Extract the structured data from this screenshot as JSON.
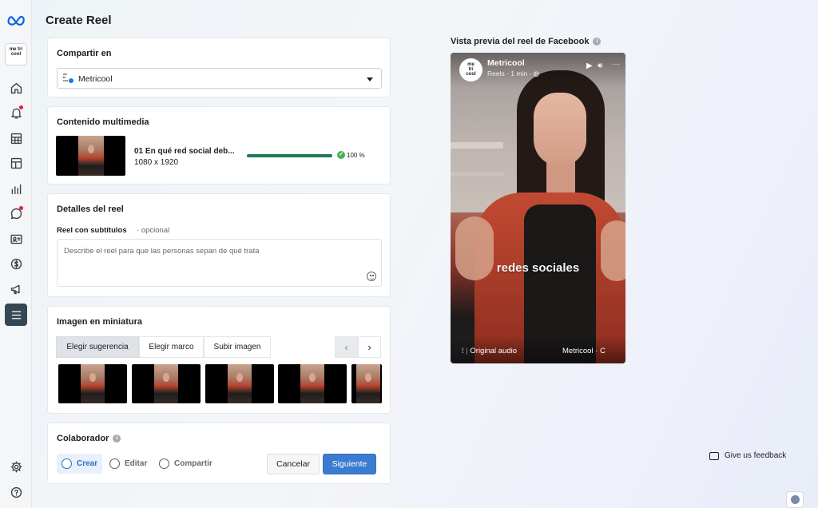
{
  "page": {
    "title": "Create Reel"
  },
  "sidebar": {
    "account_logo": "me tri cool",
    "items": [
      {
        "icon": "home-icon"
      },
      {
        "icon": "bell-icon",
        "badge": true
      },
      {
        "icon": "table-icon"
      },
      {
        "icon": "pages-icon"
      },
      {
        "icon": "bar-chart-icon"
      },
      {
        "icon": "chat-icon",
        "badge": true
      },
      {
        "icon": "contact-card-icon"
      },
      {
        "icon": "dollar-icon"
      },
      {
        "icon": "megaphone-icon"
      },
      {
        "icon": "menu-icon",
        "active": true
      }
    ],
    "bottom": [
      {
        "icon": "gear-icon"
      },
      {
        "icon": "help-icon"
      }
    ]
  },
  "share": {
    "heading": "Compartir en",
    "selected": "Metricool"
  },
  "media": {
    "heading": "Contenido multimedia",
    "file_name": "01 En qué red social deb...",
    "dimensions": "1080 x 1920",
    "progress": 1.0,
    "progress_label": "100 %"
  },
  "details": {
    "heading": "Detalles del reel",
    "field_label": "Reel con subtítulos",
    "optional": "opcional",
    "placeholder": "Describe el reel para que las personas sepan de qué trata"
  },
  "thumbnail": {
    "heading": "Imagen en miniatura",
    "tabs": [
      "Elegir sugerencia",
      "Elegir marco",
      "Subir imagen"
    ],
    "active_tab": 0
  },
  "collaborator": {
    "heading": "Colaborador"
  },
  "steps": [
    "Crear",
    "Editar",
    "Compartir"
  ],
  "actions": {
    "cancel": "Cancelar",
    "next": "Siguiente"
  },
  "preview": {
    "title": "Vista previa del reel de Facebook",
    "page_name": "Metricool",
    "meta": "Reels · 1 min ·",
    "caption": "redes sociales",
    "audio": "Original audio",
    "audio_owner": "Metricool · C"
  },
  "feedback": "Give us feedback",
  "colors": {
    "accent": "#3b7bd0",
    "progress": "#1f7a52",
    "sidebar_active": "#344854"
  }
}
